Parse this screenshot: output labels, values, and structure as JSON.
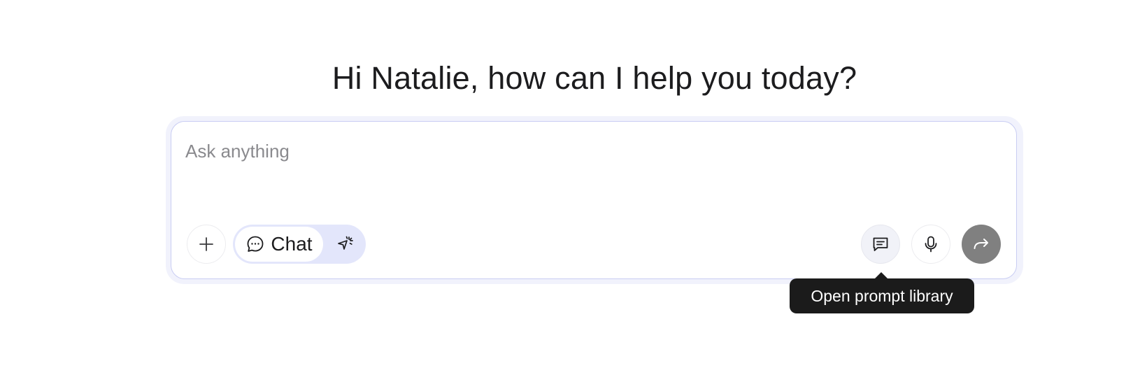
{
  "header": {
    "greeting": "Hi Natalie, how can I help you today?"
  },
  "composer": {
    "placeholder": "Ask anything",
    "value": ""
  },
  "toolbar": {
    "add_icon": "plus-icon",
    "mode": {
      "selected_label": "Chat",
      "chat_icon": "chat-bubble-icon",
      "agent_icon": "sparkle-cursor-icon",
      "selected": "Chat"
    },
    "prompt_library_icon": "message-lines-icon",
    "mic_icon": "microphone-icon",
    "send_icon": "forward-arrow-icon"
  },
  "tooltip": {
    "text": "Open prompt library"
  },
  "colors": {
    "accent_light": "#e3e6fb",
    "composer_border": "#c9cdf3",
    "send_button_disabled": "#808080",
    "tooltip_bg": "#1b1b1b"
  }
}
